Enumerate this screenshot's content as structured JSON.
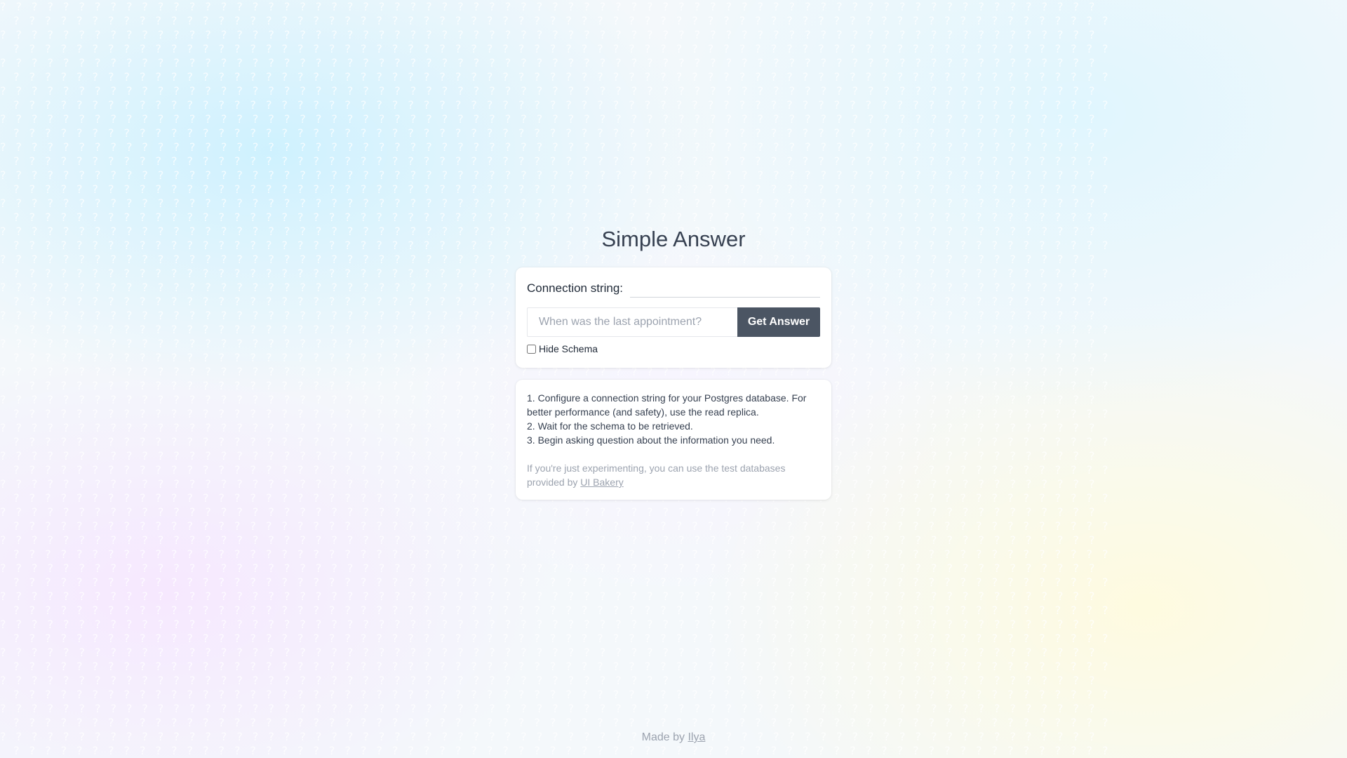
{
  "app": {
    "title": "Simple Answer"
  },
  "connection": {
    "label": "Connection string:",
    "value": ""
  },
  "question": {
    "placeholder": "When was the last appointment?",
    "value": "",
    "submit_label": "Get Answer"
  },
  "options": {
    "hide_schema_label": "Hide Schema",
    "hide_schema_checked": false
  },
  "instructions": {
    "steps": [
      "1. Configure a connection string for your Postgres database. For better performance (and safety), use the read replica.",
      "2. Wait for the schema to be retrieved.",
      "3. Begin asking question about the information you need."
    ],
    "hint_prefix": "If you're just experimenting, you can use the test databases provided by",
    "hint_link": "UI Bakery"
  },
  "footer": {
    "prefix": "Made by",
    "author": "Ilya"
  },
  "colors": {
    "button_bg": "#4b5563",
    "title": "#374151",
    "muted": "#9ca3af"
  }
}
